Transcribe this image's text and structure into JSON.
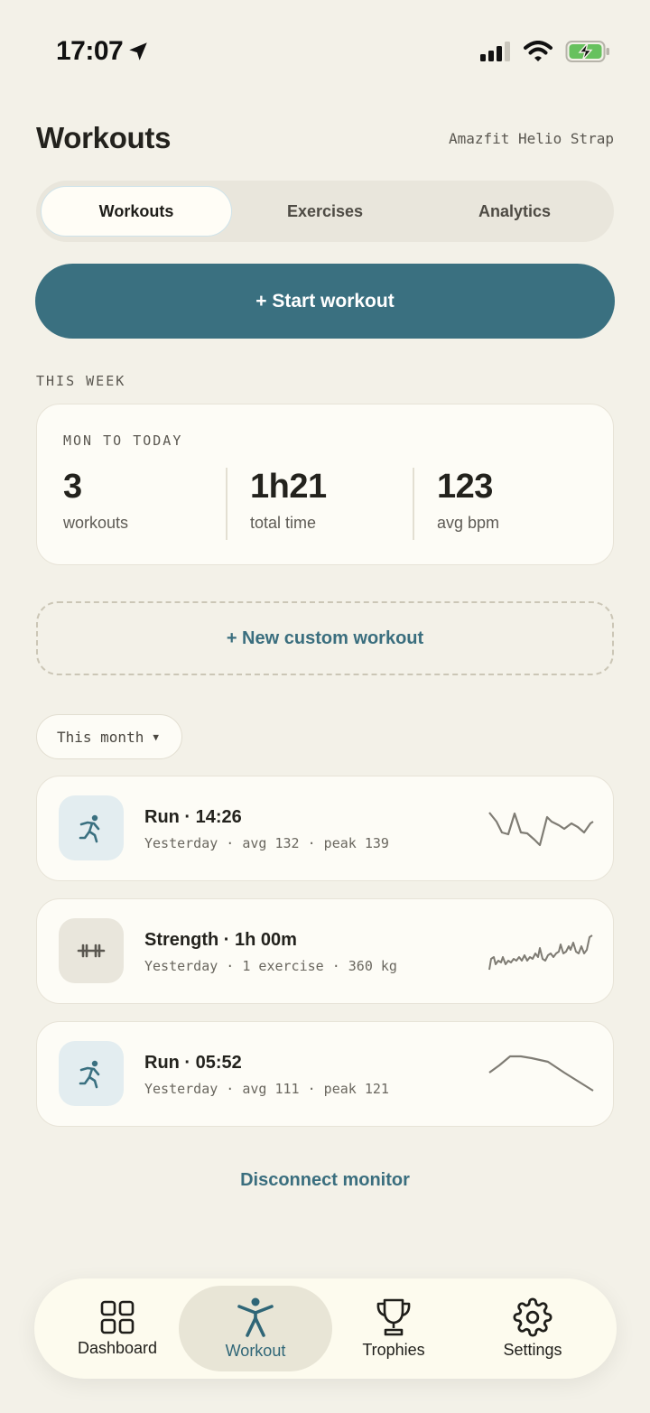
{
  "status_bar": {
    "time": "17:07"
  },
  "header": {
    "title": "Workouts",
    "device": "Amazfit Helio Strap"
  },
  "tabs": [
    {
      "label": "Workouts",
      "active": true
    },
    {
      "label": "Exercises",
      "active": false
    },
    {
      "label": "Analytics",
      "active": false
    }
  ],
  "start_button": "+ Start workout",
  "this_week": {
    "section_label": "THIS WEEK",
    "range_label": "MON TO TODAY",
    "stats": [
      {
        "value": "3",
        "unit": "workouts"
      },
      {
        "value": "1h21",
        "unit": "total time"
      },
      {
        "value": "123",
        "unit": "avg bpm"
      }
    ]
  },
  "custom_workout_button": "+ New custom workout",
  "filter": {
    "selected": "This month"
  },
  "workouts": [
    {
      "icon": "run-icon",
      "title": "Run · 14:26",
      "subtitle": "Yesterday · avg 132 · peak 139"
    },
    {
      "icon": "dumbbell-icon",
      "title": "Strength · 1h 00m",
      "subtitle": "Yesterday · 1 exercise · 360 kg"
    },
    {
      "icon": "run-icon",
      "title": "Run · 05:52",
      "subtitle": "Yesterday · avg 111 · peak 121"
    }
  ],
  "disconnect_link": "Disconnect monitor",
  "nav": [
    {
      "icon": "dashboard-icon",
      "label": "Dashboard",
      "active": false
    },
    {
      "icon": "workout-icon",
      "label": "Workout",
      "active": true
    },
    {
      "icon": "trophy-icon",
      "label": "Trophies",
      "active": false
    },
    {
      "icon": "gear-icon",
      "label": "Settings",
      "active": false
    }
  ],
  "colors": {
    "accent": "#3a7080",
    "background": "#f3f1e8",
    "battery": "#67c15e"
  }
}
